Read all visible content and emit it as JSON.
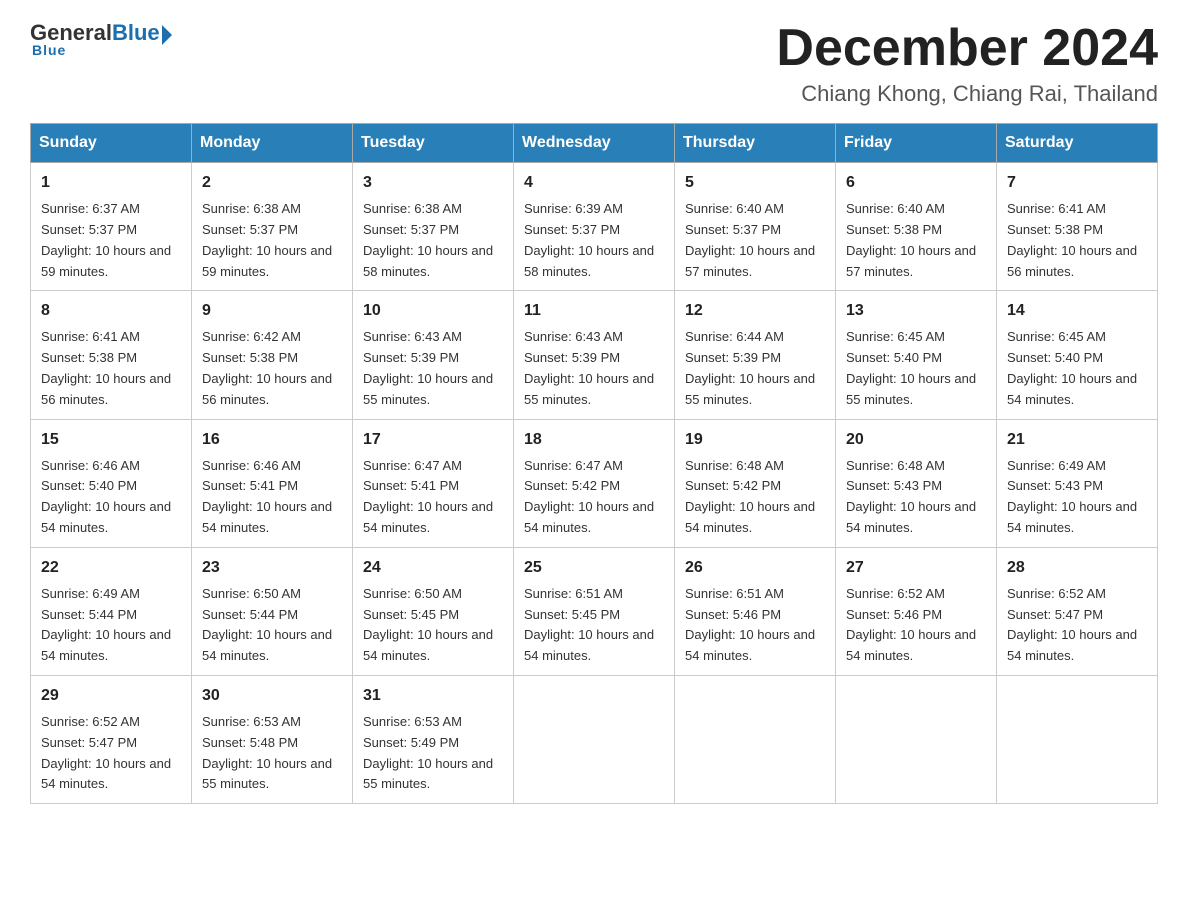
{
  "header": {
    "logo": {
      "general": "General",
      "blue": "Blue",
      "underline": "Blue"
    },
    "title": "December 2024",
    "location": "Chiang Khong, Chiang Rai, Thailand"
  },
  "weekdays": [
    "Sunday",
    "Monday",
    "Tuesday",
    "Wednesday",
    "Thursday",
    "Friday",
    "Saturday"
  ],
  "weeks": [
    [
      {
        "day": "1",
        "sunrise": "Sunrise: 6:37 AM",
        "sunset": "Sunset: 5:37 PM",
        "daylight": "Daylight: 10 hours and 59 minutes."
      },
      {
        "day": "2",
        "sunrise": "Sunrise: 6:38 AM",
        "sunset": "Sunset: 5:37 PM",
        "daylight": "Daylight: 10 hours and 59 minutes."
      },
      {
        "day": "3",
        "sunrise": "Sunrise: 6:38 AM",
        "sunset": "Sunset: 5:37 PM",
        "daylight": "Daylight: 10 hours and 58 minutes."
      },
      {
        "day": "4",
        "sunrise": "Sunrise: 6:39 AM",
        "sunset": "Sunset: 5:37 PM",
        "daylight": "Daylight: 10 hours and 58 minutes."
      },
      {
        "day": "5",
        "sunrise": "Sunrise: 6:40 AM",
        "sunset": "Sunset: 5:37 PM",
        "daylight": "Daylight: 10 hours and 57 minutes."
      },
      {
        "day": "6",
        "sunrise": "Sunrise: 6:40 AM",
        "sunset": "Sunset: 5:38 PM",
        "daylight": "Daylight: 10 hours and 57 minutes."
      },
      {
        "day": "7",
        "sunrise": "Sunrise: 6:41 AM",
        "sunset": "Sunset: 5:38 PM",
        "daylight": "Daylight: 10 hours and 56 minutes."
      }
    ],
    [
      {
        "day": "8",
        "sunrise": "Sunrise: 6:41 AM",
        "sunset": "Sunset: 5:38 PM",
        "daylight": "Daylight: 10 hours and 56 minutes."
      },
      {
        "day": "9",
        "sunrise": "Sunrise: 6:42 AM",
        "sunset": "Sunset: 5:38 PM",
        "daylight": "Daylight: 10 hours and 56 minutes."
      },
      {
        "day": "10",
        "sunrise": "Sunrise: 6:43 AM",
        "sunset": "Sunset: 5:39 PM",
        "daylight": "Daylight: 10 hours and 55 minutes."
      },
      {
        "day": "11",
        "sunrise": "Sunrise: 6:43 AM",
        "sunset": "Sunset: 5:39 PM",
        "daylight": "Daylight: 10 hours and 55 minutes."
      },
      {
        "day": "12",
        "sunrise": "Sunrise: 6:44 AM",
        "sunset": "Sunset: 5:39 PM",
        "daylight": "Daylight: 10 hours and 55 minutes."
      },
      {
        "day": "13",
        "sunrise": "Sunrise: 6:45 AM",
        "sunset": "Sunset: 5:40 PM",
        "daylight": "Daylight: 10 hours and 55 minutes."
      },
      {
        "day": "14",
        "sunrise": "Sunrise: 6:45 AM",
        "sunset": "Sunset: 5:40 PM",
        "daylight": "Daylight: 10 hours and 54 minutes."
      }
    ],
    [
      {
        "day": "15",
        "sunrise": "Sunrise: 6:46 AM",
        "sunset": "Sunset: 5:40 PM",
        "daylight": "Daylight: 10 hours and 54 minutes."
      },
      {
        "day": "16",
        "sunrise": "Sunrise: 6:46 AM",
        "sunset": "Sunset: 5:41 PM",
        "daylight": "Daylight: 10 hours and 54 minutes."
      },
      {
        "day": "17",
        "sunrise": "Sunrise: 6:47 AM",
        "sunset": "Sunset: 5:41 PM",
        "daylight": "Daylight: 10 hours and 54 minutes."
      },
      {
        "day": "18",
        "sunrise": "Sunrise: 6:47 AM",
        "sunset": "Sunset: 5:42 PM",
        "daylight": "Daylight: 10 hours and 54 minutes."
      },
      {
        "day": "19",
        "sunrise": "Sunrise: 6:48 AM",
        "sunset": "Sunset: 5:42 PM",
        "daylight": "Daylight: 10 hours and 54 minutes."
      },
      {
        "day": "20",
        "sunrise": "Sunrise: 6:48 AM",
        "sunset": "Sunset: 5:43 PM",
        "daylight": "Daylight: 10 hours and 54 minutes."
      },
      {
        "day": "21",
        "sunrise": "Sunrise: 6:49 AM",
        "sunset": "Sunset: 5:43 PM",
        "daylight": "Daylight: 10 hours and 54 minutes."
      }
    ],
    [
      {
        "day": "22",
        "sunrise": "Sunrise: 6:49 AM",
        "sunset": "Sunset: 5:44 PM",
        "daylight": "Daylight: 10 hours and 54 minutes."
      },
      {
        "day": "23",
        "sunrise": "Sunrise: 6:50 AM",
        "sunset": "Sunset: 5:44 PM",
        "daylight": "Daylight: 10 hours and 54 minutes."
      },
      {
        "day": "24",
        "sunrise": "Sunrise: 6:50 AM",
        "sunset": "Sunset: 5:45 PM",
        "daylight": "Daylight: 10 hours and 54 minutes."
      },
      {
        "day": "25",
        "sunrise": "Sunrise: 6:51 AM",
        "sunset": "Sunset: 5:45 PM",
        "daylight": "Daylight: 10 hours and 54 minutes."
      },
      {
        "day": "26",
        "sunrise": "Sunrise: 6:51 AM",
        "sunset": "Sunset: 5:46 PM",
        "daylight": "Daylight: 10 hours and 54 minutes."
      },
      {
        "day": "27",
        "sunrise": "Sunrise: 6:52 AM",
        "sunset": "Sunset: 5:46 PM",
        "daylight": "Daylight: 10 hours and 54 minutes."
      },
      {
        "day": "28",
        "sunrise": "Sunrise: 6:52 AM",
        "sunset": "Sunset: 5:47 PM",
        "daylight": "Daylight: 10 hours and 54 minutes."
      }
    ],
    [
      {
        "day": "29",
        "sunrise": "Sunrise: 6:52 AM",
        "sunset": "Sunset: 5:47 PM",
        "daylight": "Daylight: 10 hours and 54 minutes."
      },
      {
        "day": "30",
        "sunrise": "Sunrise: 6:53 AM",
        "sunset": "Sunset: 5:48 PM",
        "daylight": "Daylight: 10 hours and 55 minutes."
      },
      {
        "day": "31",
        "sunrise": "Sunrise: 6:53 AM",
        "sunset": "Sunset: 5:49 PM",
        "daylight": "Daylight: 10 hours and 55 minutes."
      },
      null,
      null,
      null,
      null
    ]
  ]
}
